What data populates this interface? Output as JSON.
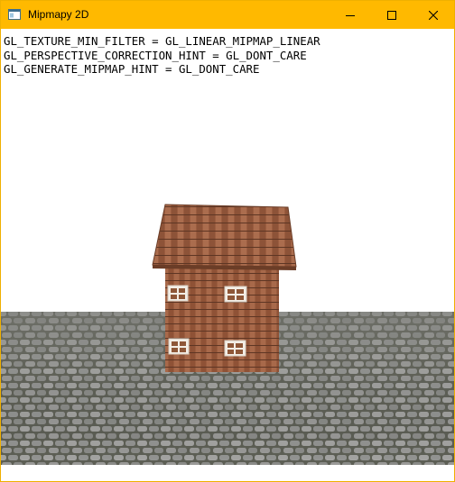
{
  "window": {
    "title": "Mipmapy 2D",
    "controls": {
      "minimize_icon": "minimize-icon",
      "maximize_icon": "maximize-icon",
      "close_icon": "close-icon"
    },
    "title_bar_color": "#ffb900"
  },
  "hints": [
    "GL_TEXTURE_MIN_FILTER = GL_LINEAR_MIPMAP_LINEAR",
    "GL_PERSPECTIVE_CORRECTION_HINT = GL_DONT_CARE",
    "GL_GENERATE_MIPMAP_HINT = GL_DONT_CARE"
  ],
  "scene": {
    "background_color": "#ffffff",
    "ground_texture": "cobblestone",
    "object": "textured-house-model"
  }
}
